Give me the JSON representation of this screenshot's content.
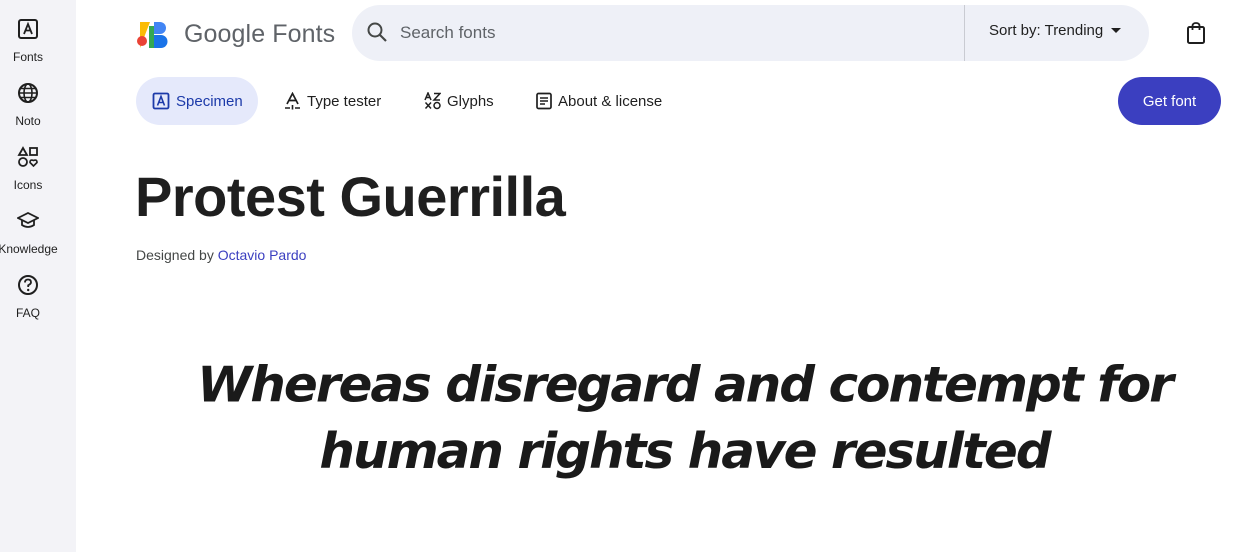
{
  "rail": {
    "items": [
      {
        "label": "Fonts",
        "icon": "font-box-icon"
      },
      {
        "label": "Noto",
        "icon": "globe-icon"
      },
      {
        "label": "Icons",
        "icon": "shapes-icon"
      },
      {
        "label": "Knowledge",
        "icon": "school-icon"
      },
      {
        "label": "FAQ",
        "icon": "help-icon"
      }
    ]
  },
  "header": {
    "logo_text": "Google Fonts",
    "search_placeholder": "Search fonts",
    "sort_label": "Sort by: Trending"
  },
  "tabs": [
    {
      "label": "Specimen",
      "icon": "font-box-icon",
      "active": true
    },
    {
      "label": "Type tester",
      "icon": "text-cursor-icon",
      "active": false
    },
    {
      "label": "Glyphs",
      "icon": "glyphs-icon",
      "active": false
    },
    {
      "label": "About & license",
      "icon": "article-icon",
      "active": false
    }
  ],
  "get_font_label": "Get font",
  "font": {
    "name": "Protest Guerrilla",
    "designed_by_prefix": "Designed by",
    "designer": "Octavio Pardo",
    "specimen_text": "Whereas disregard and contempt for human rights have resulted"
  },
  "colors": {
    "accent": "#3b3fc0",
    "tab_active_bg": "#e5e9fb",
    "rail_bg": "#f3f3f7",
    "search_bg": "#eef0f7"
  }
}
